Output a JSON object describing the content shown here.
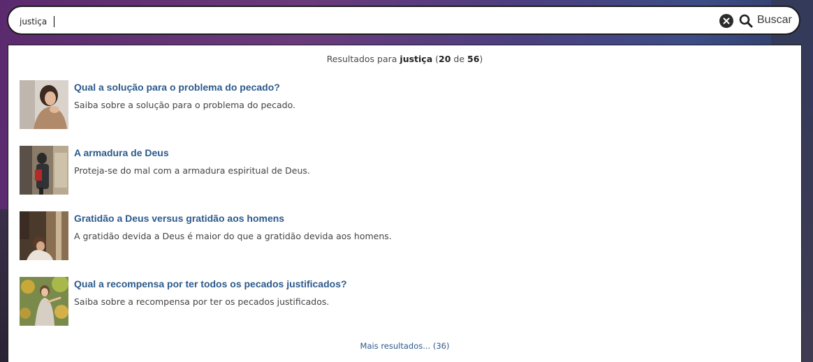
{
  "search": {
    "value": "justiça",
    "clear_icon": "close-circle-icon",
    "button_label": "Buscar",
    "button_icon": "search-icon"
  },
  "results": {
    "prefix": "Resultados para",
    "query": "justiça",
    "shown": "20",
    "of_word": "de",
    "total": "56",
    "items": [
      {
        "title": "Qual a solução para o problema do pecado?",
        "description": "Saiba sobre a solução para o problema do pecado."
      },
      {
        "title": "A armadura de Deus",
        "description": "Proteja-se do mal com a armadura espiritual de Deus."
      },
      {
        "title": "Gratidão a Deus versus gratidão aos homens",
        "description": "A gratidão devida a Deus é maior do que a gratidão devida aos homens."
      },
      {
        "title": "Qual a recompensa por ter todos os pecados justificados?",
        "description": "Saiba sobre a recompensa por ter os pecados justificados."
      }
    ],
    "more_label": "Mais resultados... (36)"
  },
  "colors": {
    "link": "#2c5a8c",
    "text": "#444444",
    "border": "#1b1b1b"
  }
}
